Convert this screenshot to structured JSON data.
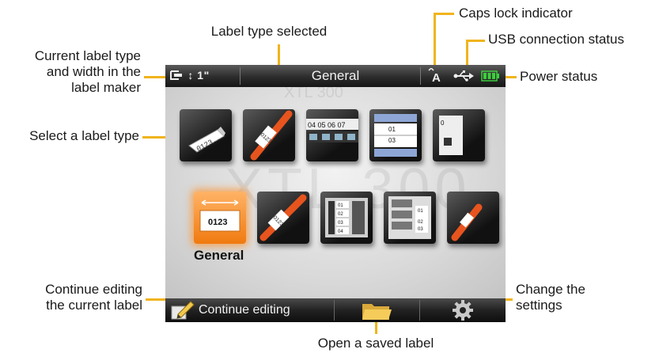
{
  "annotations": {
    "current_label_type": "Current label type\nand width in the\nlabel maker",
    "label_type_selected": "Label type selected",
    "caps_lock": "Caps lock indicator",
    "usb_status": "USB connection status",
    "power_status": "Power status",
    "select_label_type": "Select a label type",
    "continue_editing_desc": "Continue editing\nthe current label",
    "open_saved": "Open a saved label",
    "change_settings": "Change the\nsettings"
  },
  "statusbar": {
    "label_width": "↕ 1\"",
    "title": "General",
    "caps_icon": "caps-lock-icon",
    "usb_icon": "usb-icon",
    "battery_icon": "battery-icon"
  },
  "content": {
    "watermark": "XTL 300",
    "selected_caption": "General",
    "tiles_row1": [
      "flag-label",
      "wire-wrap-label",
      "patch-panel-label",
      "terminal-block-label",
      "partial-tile"
    ],
    "tiles_row2": [
      "general",
      "heat-shrink-label",
      "breaker-panel-label",
      "distribution-panel-label",
      "partial-tile"
    ],
    "general_tile_value": "0123",
    "flag_tile_value": "0123..."
  },
  "bottombar": {
    "continue_label": "Continue editing",
    "continue_icon": "pencil-edit-icon",
    "open_icon": "folder-icon",
    "settings_icon": "gear-icon"
  },
  "colors": {
    "callout": "#f0b41c",
    "selection": "#f07a10",
    "battery": "#3ccf3c"
  }
}
